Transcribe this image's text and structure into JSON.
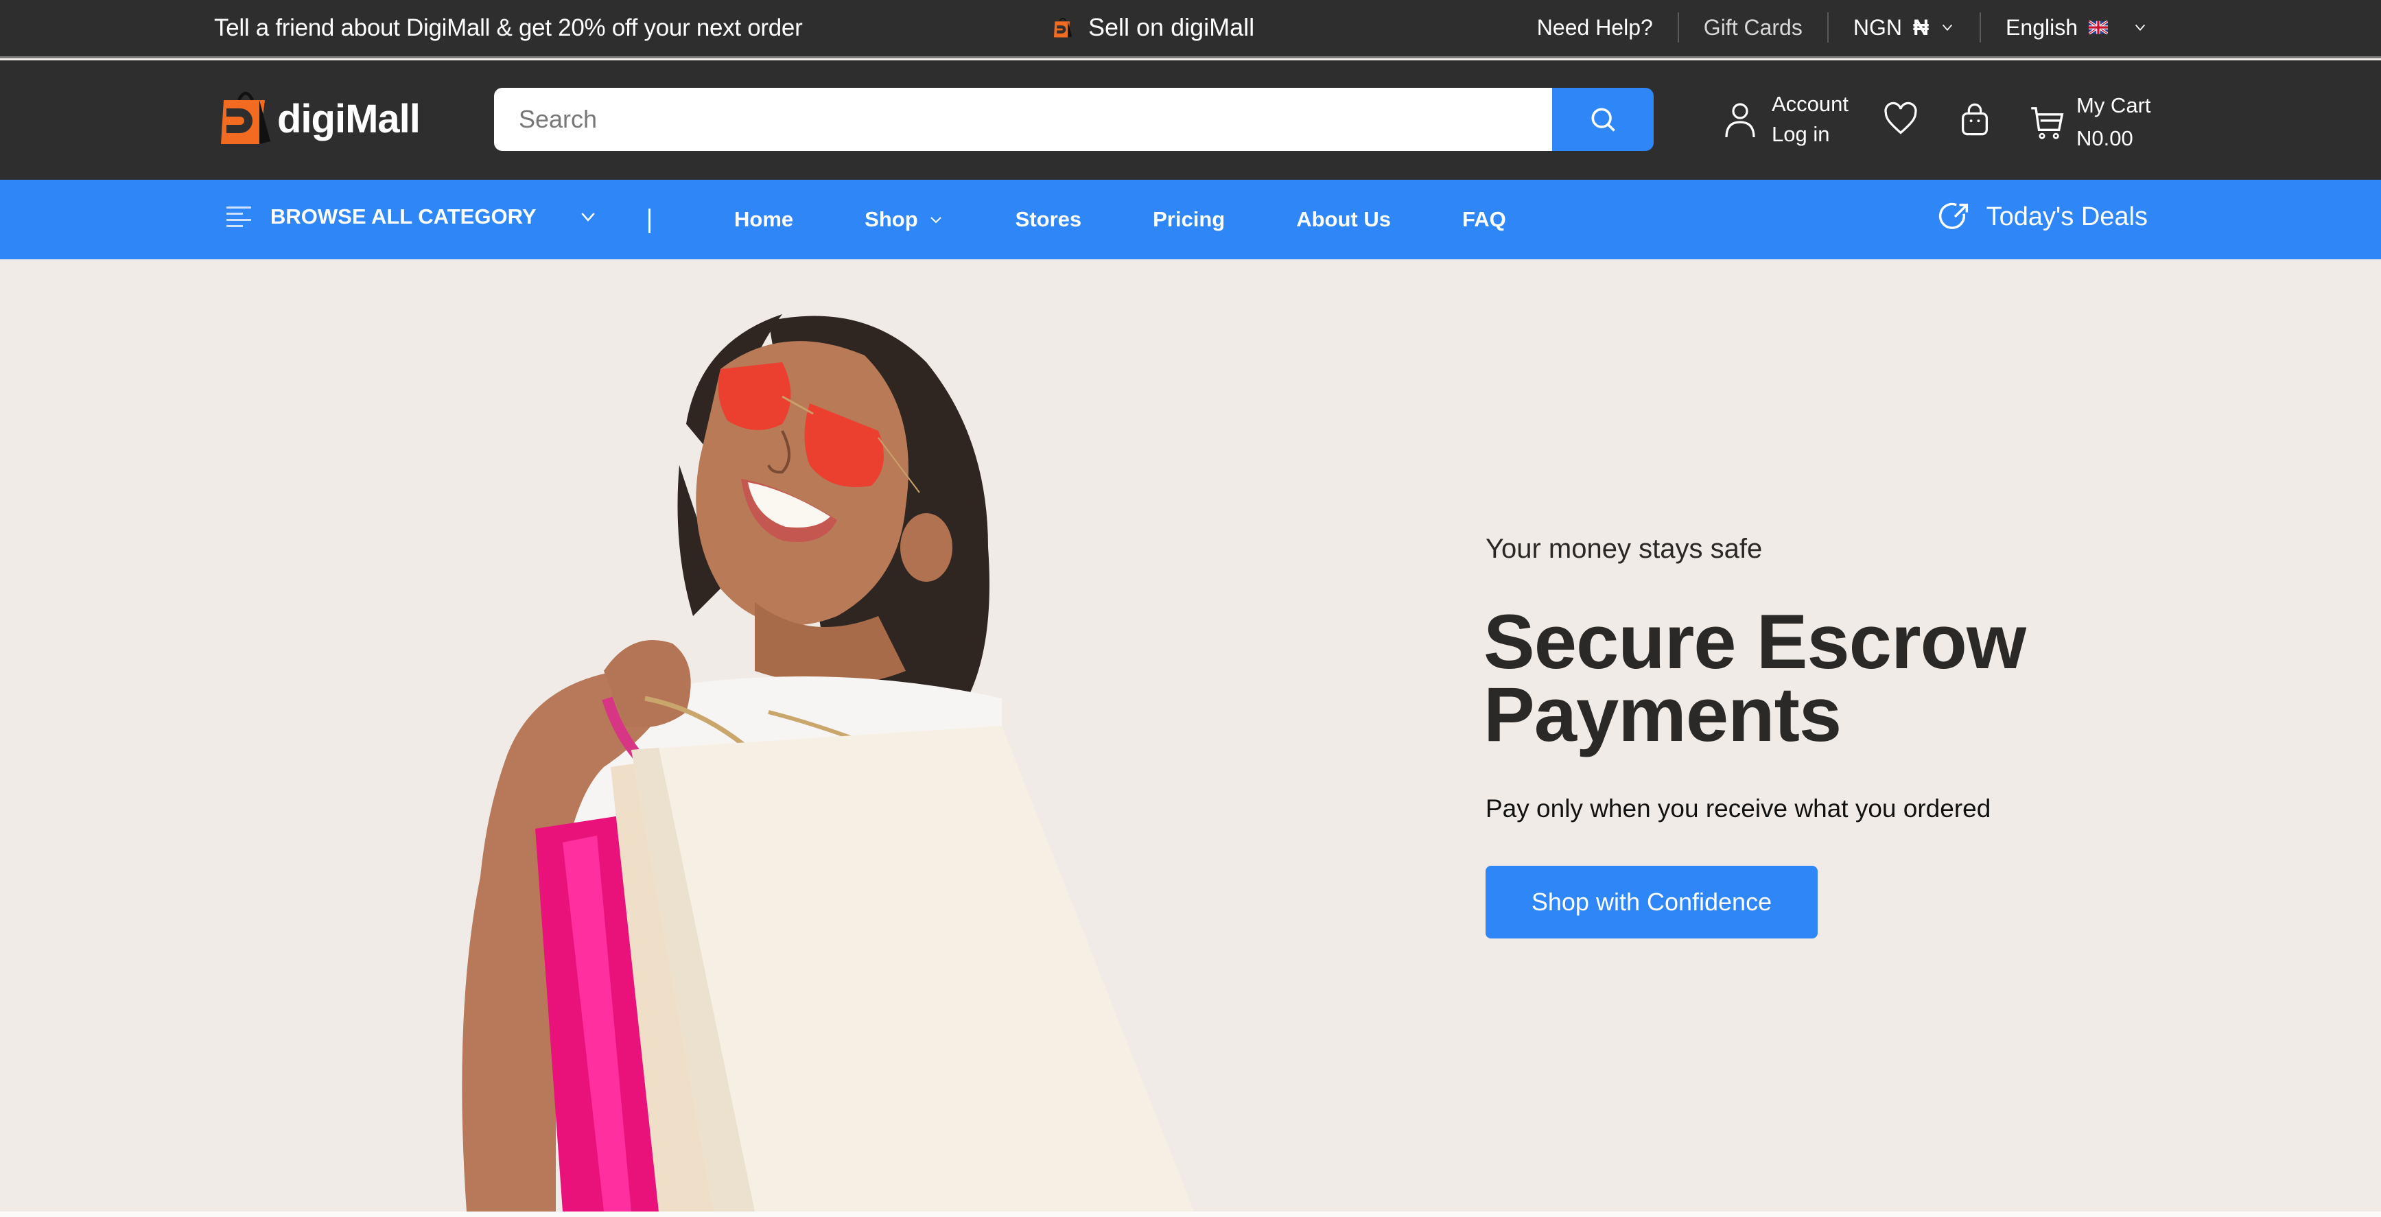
{
  "topbar": {
    "promo": "Tell a friend about DigiMall & get 20% off your next order",
    "sell_label": "Sell on digiMall",
    "help_label": "Need Help?",
    "gift_label": "Gift Cards",
    "currency_label": "NGN",
    "currency_symbol": "₦",
    "language_label": "English",
    "language_flag": "uk-flag-icon"
  },
  "header": {
    "brand": "digiMall",
    "search_placeholder": "Search",
    "search_value": "",
    "account_label": "Account",
    "login_label": "Log in",
    "cart_label": "My Cart",
    "cart_total": "N0.00"
  },
  "nav": {
    "browse_label": "BROWSE ALL CATEGORY",
    "links": [
      {
        "label": "Home",
        "dropdown": false
      },
      {
        "label": "Shop",
        "dropdown": true
      },
      {
        "label": "Stores",
        "dropdown": false
      },
      {
        "label": "Pricing",
        "dropdown": false
      },
      {
        "label": "About Us",
        "dropdown": false
      },
      {
        "label": "FAQ",
        "dropdown": false
      }
    ],
    "deals_label": "Today's Deals"
  },
  "hero": {
    "eyebrow": "Your money stays safe",
    "headline_line1": "Secure Escrow",
    "headline_line2": "Payments",
    "subtext": "Pay only when you receive what you ordered",
    "cta_label": "Shop with Confidence",
    "image_alt": "Smiling woman with red sunglasses carrying shopping bags"
  },
  "colors": {
    "dark_bar": "#2e2e2e",
    "accent_blue": "#2f86f6",
    "brand_orange": "#f26b21",
    "hero_bg": "#f0ebe6",
    "headline": "#2b2927"
  }
}
